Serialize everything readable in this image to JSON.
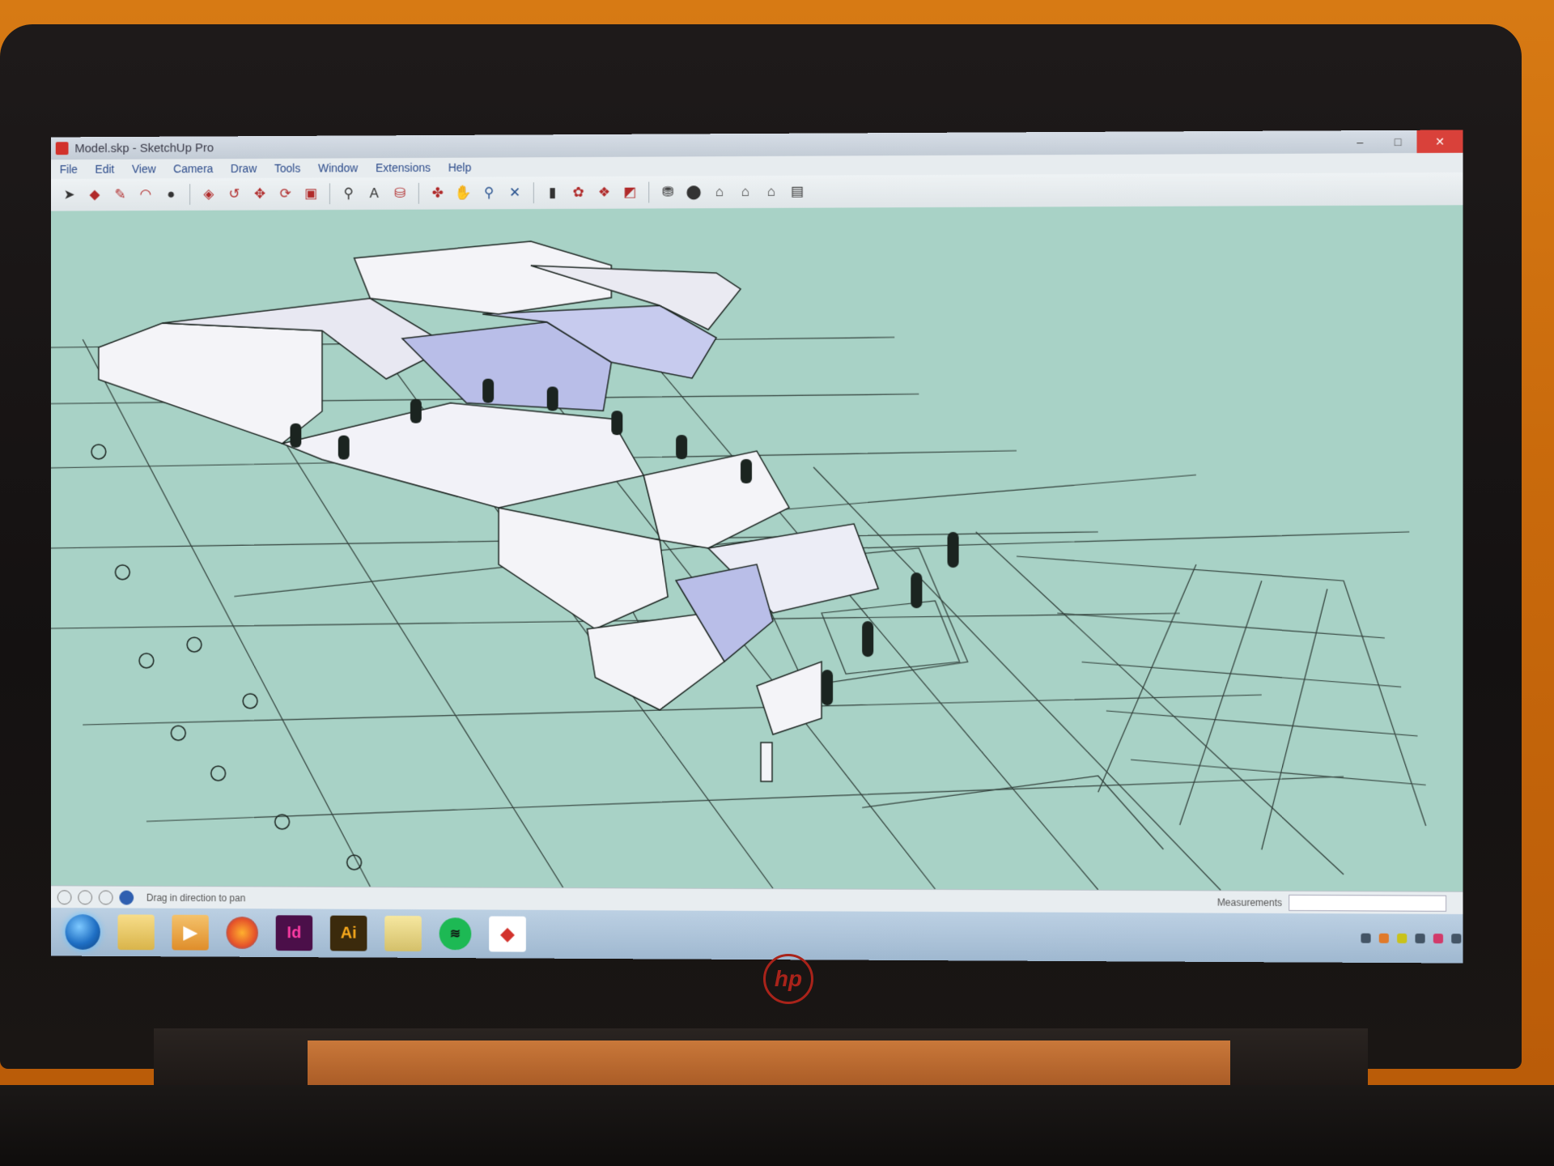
{
  "window": {
    "title": "Model.skp - SketchUp Pro",
    "controls": [
      "–",
      "□",
      "✕"
    ]
  },
  "menu": [
    "File",
    "Edit",
    "View",
    "Camera",
    "Draw",
    "Tools",
    "Window",
    "Extensions",
    "Help"
  ],
  "toolbar_icons": [
    "select-arrow-icon",
    "eraser-icon",
    "pencil-icon",
    "arc-icon",
    "circle-icon",
    "push-pull-icon",
    "follow-me-icon",
    "move-icon",
    "rotate-icon",
    "scale-icon",
    "tape-measure-icon",
    "text-icon",
    "paint-bucket-icon",
    "orbit-icon",
    "pan-icon",
    "zoom-icon",
    "zoom-extents-icon",
    "section-icon",
    "component-icon",
    "warehouse-icon",
    "extension-icon",
    "layers-icon",
    "shadow-icon",
    "home-icon",
    "scene-icon",
    "outline-icon",
    "window-icon"
  ],
  "status": {
    "hint": "Drag in direction to pan",
    "measurements_label": "Measurements"
  },
  "taskbar": {
    "apps": [
      "start",
      "explorer",
      "media",
      "firefox",
      "Id",
      "Ai",
      "folder",
      "spotify",
      "sketchup"
    ],
    "id_label": "Id",
    "ai_label": "Ai"
  },
  "brand": {
    "laptop": "hp"
  },
  "colors": {
    "viewport_bg": "#a8d2c6",
    "wall": "#f4f4f8",
    "wall_shaded": "#b9bee8",
    "ink": "#1b2420",
    "close_button": "#d9413a"
  }
}
